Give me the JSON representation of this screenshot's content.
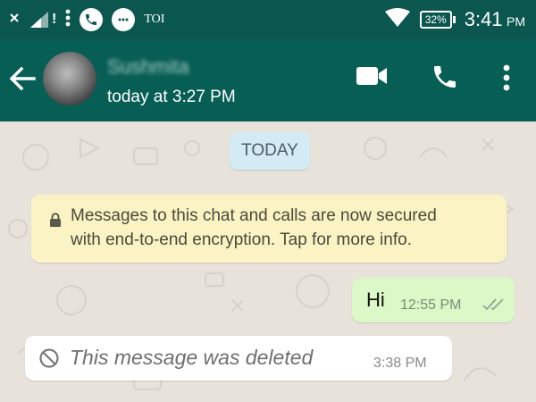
{
  "status_bar": {
    "carrier": "TOI",
    "signal_marker": "!",
    "battery": "32%",
    "time_main": "3:41",
    "time_suffix": "PM",
    "icons": [
      "close-icon",
      "signal-icon",
      "more-vert-icon",
      "phone-icon",
      "chat-bubble-icon",
      "wifi-icon",
      "battery-icon"
    ]
  },
  "chat_header": {
    "contact_name": "Sushmita",
    "last_seen": "today at 3:27 PM",
    "icons": [
      "back-arrow-icon",
      "video-call-icon",
      "voice-call-icon",
      "more-vert-icon"
    ]
  },
  "conversation": {
    "date_chip": "TODAY",
    "encryption_notice": {
      "line1": "Messages to this chat and calls are now secured",
      "line2": "with end-to-end encryption. Tap for more info."
    },
    "messages": [
      {
        "direction": "outgoing",
        "text": "Hi",
        "time": "12:55 PM",
        "status": "read"
      },
      {
        "direction": "incoming",
        "text": "This message was deleted",
        "time": "3:38 PM"
      }
    ]
  },
  "colors": {
    "status_bar_bg": "#0b574f",
    "app_bar_bg": "#075e54",
    "chat_bg": "#e7e2da",
    "outgoing_bubble": "#dcf8c6",
    "incoming_bubble": "#ffffff",
    "date_chip_bg": "#d4eaf4",
    "notice_bg": "#fcf3c4"
  }
}
